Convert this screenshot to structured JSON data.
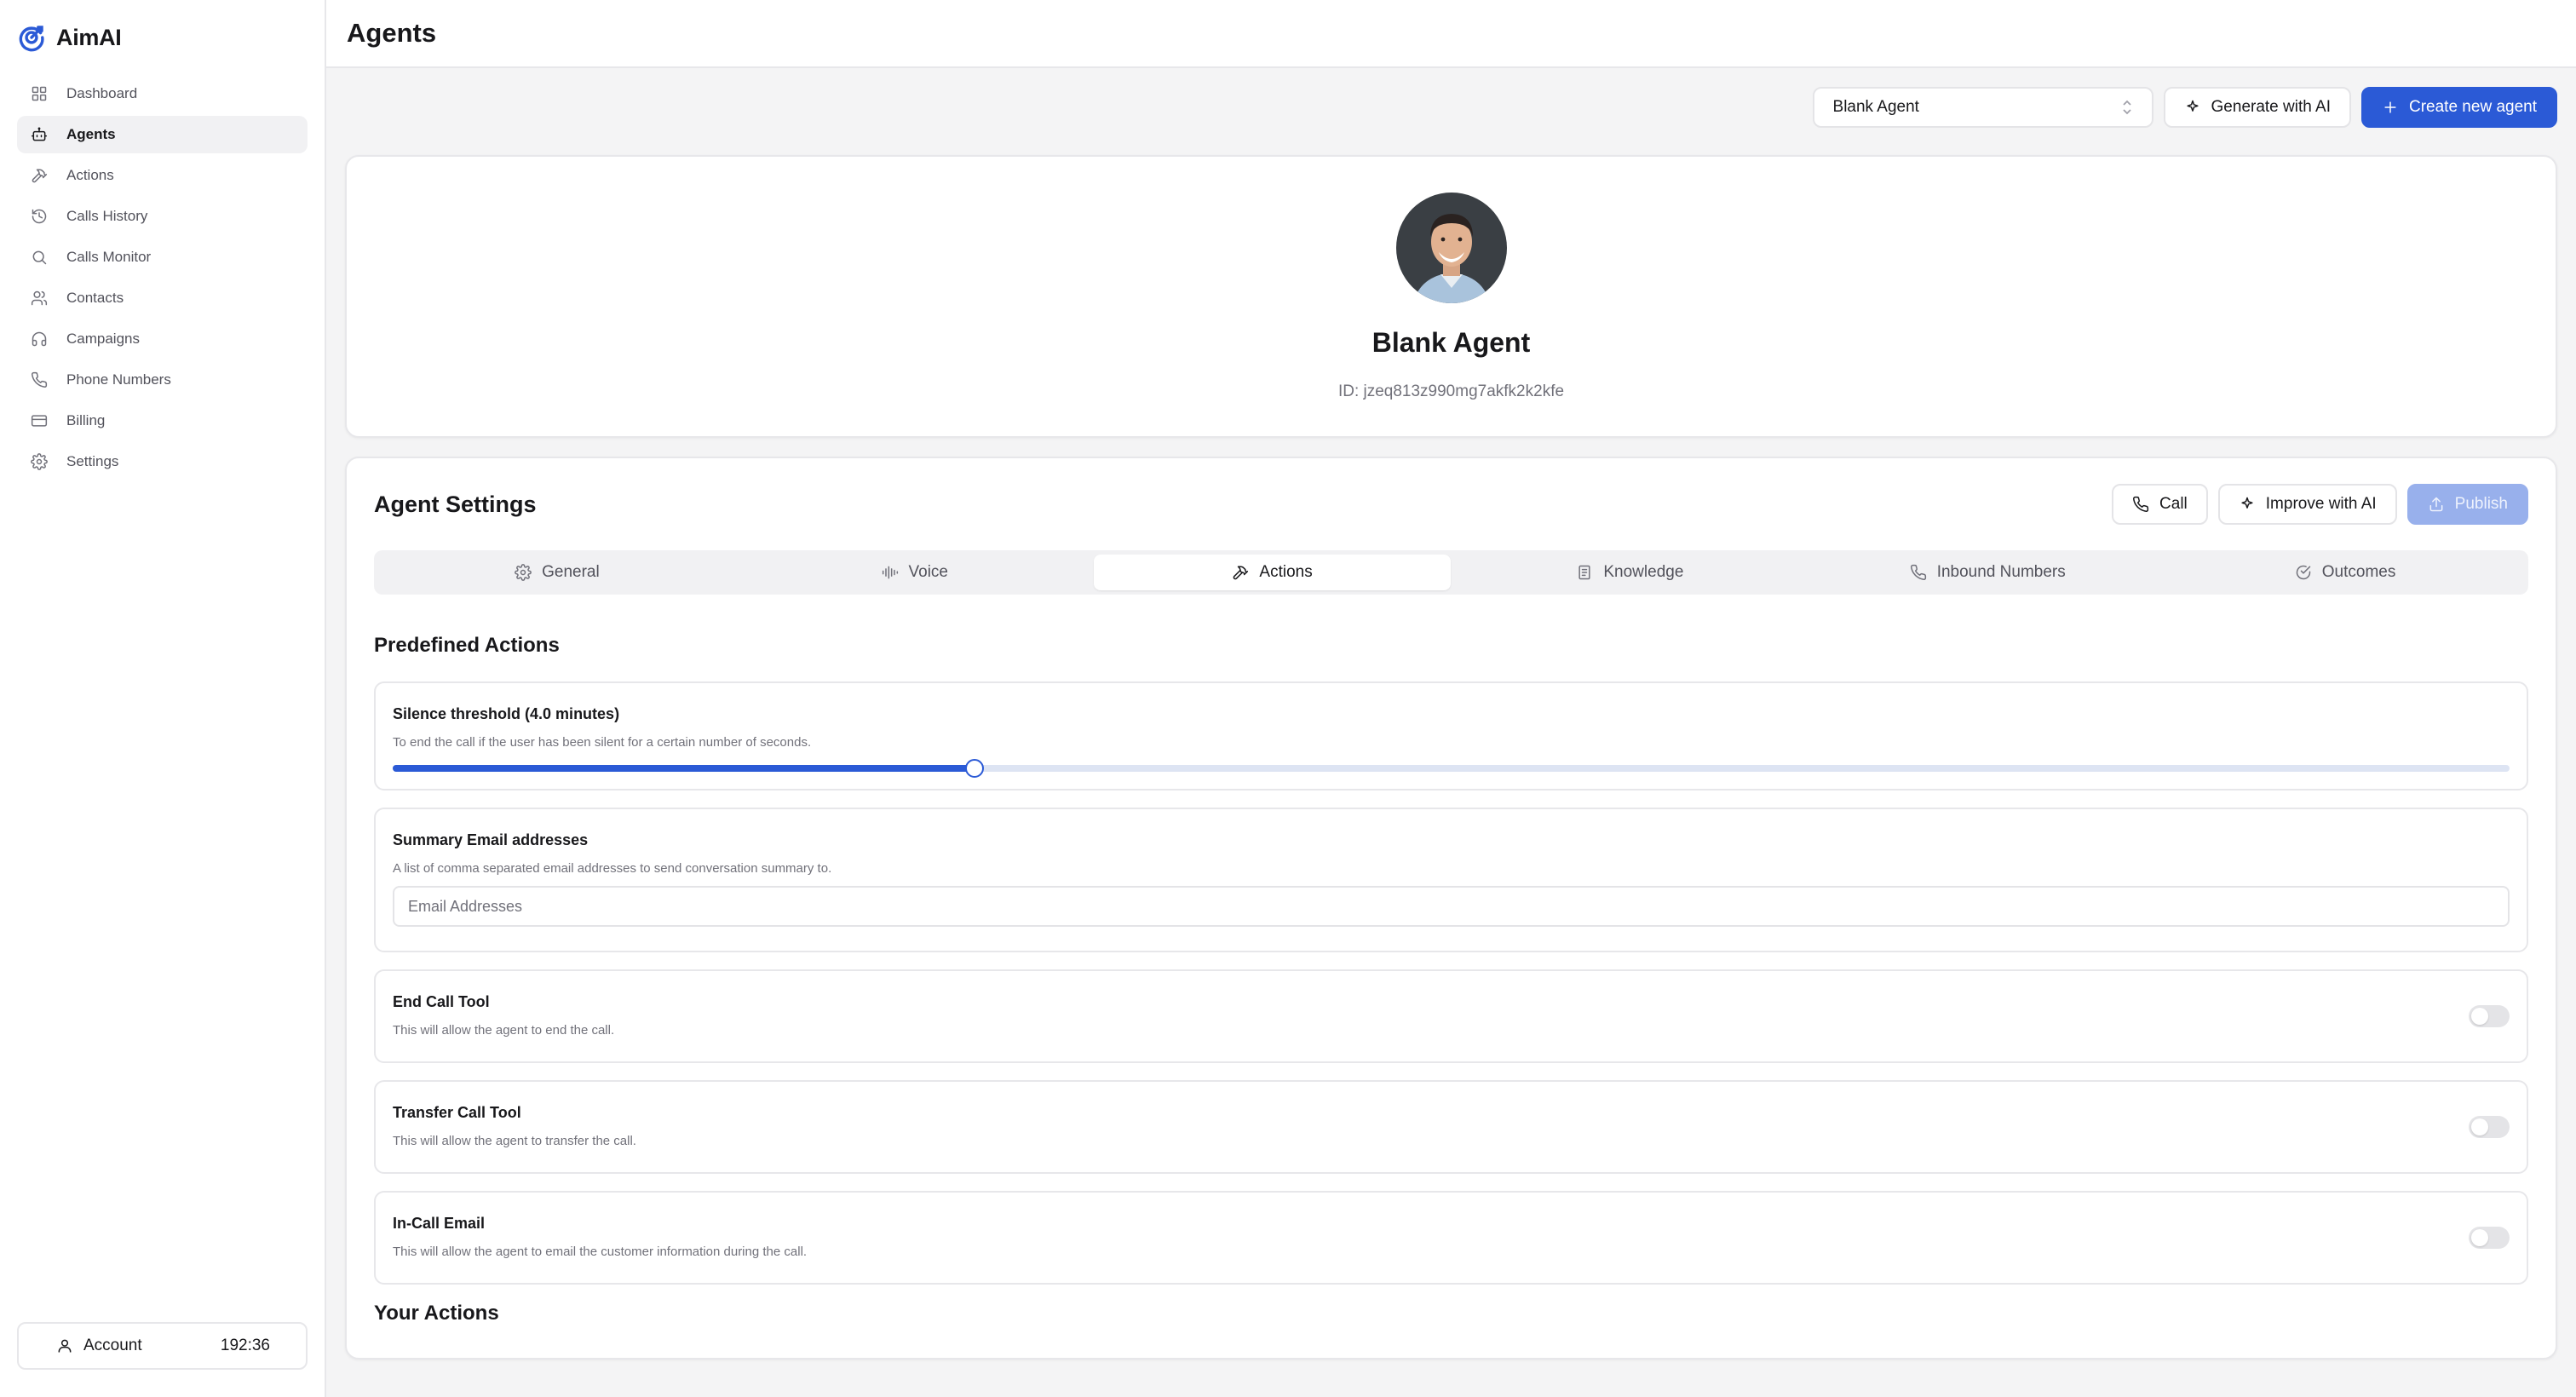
{
  "brand": {
    "name": "AimAI"
  },
  "sidebar": {
    "items": [
      {
        "label": "Dashboard",
        "icon": "grid-icon"
      },
      {
        "label": "Agents",
        "icon": "bot-icon",
        "active": true
      },
      {
        "label": "Actions",
        "icon": "hammer-icon"
      },
      {
        "label": "Calls History",
        "icon": "history-icon"
      },
      {
        "label": "Calls Monitor",
        "icon": "search-icon"
      },
      {
        "label": "Contacts",
        "icon": "users-icon"
      },
      {
        "label": "Campaigns",
        "icon": "headset-icon"
      },
      {
        "label": "Phone Numbers",
        "icon": "phone-icon"
      },
      {
        "label": "Billing",
        "icon": "credit-card-icon"
      },
      {
        "label": "Settings",
        "icon": "gear-icon"
      }
    ],
    "account": {
      "label": "Account",
      "balance": "192:36"
    }
  },
  "header": {
    "title": "Agents"
  },
  "toolbar": {
    "agent_select": "Blank Agent",
    "generate_label": "Generate with AI",
    "create_label": "Create new agent"
  },
  "profile": {
    "name": "Blank Agent",
    "id": "ID: jzeq813z990mg7akfk2k2kfe"
  },
  "settings": {
    "title": "Agent Settings",
    "call_label": "Call",
    "improve_label": "Improve with AI",
    "publish_label": "Publish",
    "tabs": [
      {
        "label": "General",
        "icon": "gear-icon"
      },
      {
        "label": "Voice",
        "icon": "audio-wave-icon"
      },
      {
        "label": "Actions",
        "icon": "hammer-icon",
        "active": true
      },
      {
        "label": "Knowledge",
        "icon": "book-icon"
      },
      {
        "label": "Inbound Numbers",
        "icon": "phone-icon"
      },
      {
        "label": "Outcomes",
        "icon": "check-circle-icon"
      }
    ]
  },
  "predefined": {
    "title": "Predefined Actions",
    "silence": {
      "title": "Silence threshold (4.0 minutes)",
      "desc": "To end the call if the user has been silent for a certain number of seconds.",
      "fraction": 0.275
    },
    "email": {
      "title": "Summary Email addresses",
      "desc": "A list of comma separated email addresses to send conversation summary to.",
      "placeholder": "Email Addresses"
    },
    "end_call": {
      "title": "End Call Tool",
      "desc": "This will allow the agent to end the call.",
      "enabled": false
    },
    "transfer": {
      "title": "Transfer Call Tool",
      "desc": "This will allow the agent to transfer the call.",
      "enabled": false
    },
    "in_call_email": {
      "title": "In-Call Email",
      "desc": "This will allow the agent to email the customer information during the call.",
      "enabled": false
    }
  },
  "your_actions": {
    "title": "Your Actions"
  },
  "colors": {
    "accent": "#2b5ad6",
    "accent_disabled": "#98b0ec",
    "background": "#f4f4f5"
  }
}
